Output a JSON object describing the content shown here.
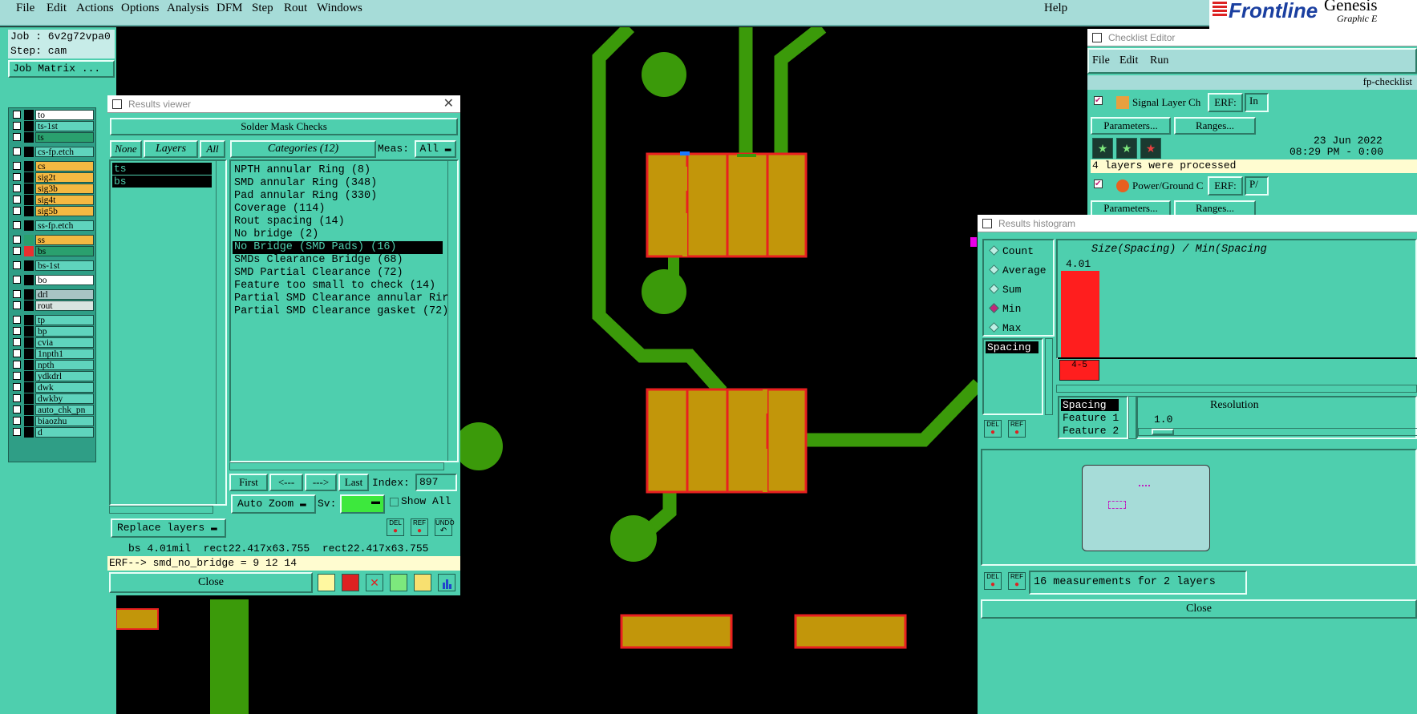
{
  "menubar": {
    "items": [
      "File",
      "Edit",
      "Actions",
      "Options",
      "Analysis",
      "DFM",
      "Step",
      "Rout",
      "Windows"
    ],
    "help": "Help",
    "logo": "Frontline",
    "logo_extra": "Genesis",
    "logo_sub": "Graphic E"
  },
  "job": {
    "job_label": "Job : 6v2g72vpa0",
    "step_label": "Step: cam",
    "matrix_button": "Job Matrix ..."
  },
  "layers": [
    {
      "name": "to",
      "color": "#ffffff",
      "swatch": "#000000"
    },
    {
      "name": "ts-1st",
      "color": "#5fd4bd",
      "swatch": "#000000"
    },
    {
      "name": "ts",
      "color": "#2aa06e",
      "swatch": "#000000"
    },
    {
      "name": "cs-fp.etch",
      "color": "#5fd4bd",
      "swatch": "#000000"
    },
    {
      "name": "cs",
      "color": "#f4b942",
      "swatch": "#000000"
    },
    {
      "name": "sig2t",
      "color": "#f4b942",
      "swatch": "#000000"
    },
    {
      "name": "sig3b",
      "color": "#f4b942",
      "swatch": "#000000"
    },
    {
      "name": "sig4t",
      "color": "#f4b942",
      "swatch": "#000000"
    },
    {
      "name": "sig5b",
      "color": "#f4b942",
      "swatch": "#000000"
    },
    {
      "name": "ss-fp.etch",
      "color": "#5fd4bd",
      "swatch": "#000000"
    },
    {
      "name": "ss",
      "color": "#f4b942",
      "swatch": "#2aa06e"
    },
    {
      "name": "bs",
      "color": "#2aa06e",
      "swatch": "#e83030"
    },
    {
      "name": "bs-1st",
      "color": "#5fd4bd",
      "swatch": "#000000"
    },
    {
      "name": "bo",
      "color": "#ffffff",
      "swatch": "#000000"
    },
    {
      "name": "drl",
      "color": "#a8c4c4",
      "swatch": "#000000"
    },
    {
      "name": "rout",
      "color": "#d8e4e0",
      "swatch": "#000000"
    },
    {
      "name": "tp",
      "color": "#5fd4bd",
      "swatch": "#000000"
    },
    {
      "name": "bp",
      "color": "#5fd4bd",
      "swatch": "#000000"
    },
    {
      "name": "cvia",
      "color": "#5fd4bd",
      "swatch": "#000000"
    },
    {
      "name": "1npth1",
      "color": "#5fd4bd",
      "swatch": "#000000"
    },
    {
      "name": "npth",
      "color": "#5fd4bd",
      "swatch": "#000000"
    },
    {
      "name": "ydkdrl",
      "color": "#5fd4bd",
      "swatch": "#000000"
    },
    {
      "name": "dwk",
      "color": "#5fd4bd",
      "swatch": "#000000"
    },
    {
      "name": "dwkby",
      "color": "#5fd4bd",
      "swatch": "#000000"
    },
    {
      "name": "auto_chk_pn",
      "color": "#5fd4bd",
      "swatch": "#000000"
    },
    {
      "name": "biaozhu",
      "color": "#5fd4bd",
      "swatch": "#000000"
    },
    {
      "name": "d",
      "color": "#5fd4bd",
      "swatch": "#000000"
    }
  ],
  "results_viewer": {
    "title": "Results viewer",
    "heading": "Solder Mask Checks",
    "none_btn": "None",
    "layers_btn": "Layers",
    "all_btn": "All",
    "categories_btn": "Categories (12)",
    "meas_label": "Meas:",
    "meas_value": "All",
    "layer_list": [
      "ts",
      "bs"
    ],
    "categories": [
      "NPTH annular Ring (8)",
      "SMD annular Ring (348)",
      "Pad annular Ring (330)",
      "Coverage (114)",
      "Rout spacing (14)",
      "No bridge (2)",
      "No Bridge (SMD Pads) (16)",
      "SMDs Clearance Bridge (68)",
      "SMD Partial Clearance (72)",
      "Feature too small to check (14)",
      "Partial SMD Clearance annular Rir",
      "Partial SMD Clearance gasket (72)"
    ],
    "selected_index": 6,
    "first": "First",
    "prev": "<---",
    "next": "--->",
    "last": "Last",
    "index_label": "Index:",
    "index_value": "897",
    "auto_zoom": "Auto Zoom",
    "sv_label": "Sv:",
    "show_all": "Show All",
    "replace_layers": "Replace layers",
    "del": "DEL",
    "ref": "REF",
    "undo": "UNDO",
    "status_line": "bs 4.01mil  rect22.417x63.755  rect22.417x63.755",
    "erf_line": "ERF--> smd_no_bridge = 9 12 14",
    "close": "Close"
  },
  "checklist": {
    "title": "Checklist Editor",
    "menu": [
      "File",
      "Edit",
      "Run"
    ],
    "name": "fp-checklist",
    "item1_label": "Signal Layer Ch",
    "erf": "ERF:",
    "params": "Parameters...",
    "ranges": "Ranges...",
    "date": "23 Jun 2022",
    "time": "08:29 PM - 0:00",
    "processed": "4 layers were processed",
    "item2_label": "Power/Ground C",
    "item1_extra": "In",
    "item2_extra": "P/"
  },
  "histogram": {
    "title": "Results histogram",
    "radios": [
      "Count",
      "Average",
      "Sum",
      "Min",
      "Max"
    ],
    "selected_radio": "Min",
    "measure_list": [
      "Spacing"
    ],
    "chart_title": "Size(Spacing) / Min(Spacing",
    "bar_value": "4.01",
    "bar_range": "4-5",
    "field_list": [
      "Spacing",
      "Feature 1",
      "Feature 2"
    ],
    "resolution_label": "Resolution",
    "resolution_value": "1.0",
    "summary": "16 measurements for 2 layers",
    "close": "Close",
    "del": "DEL",
    "ref": "REF"
  }
}
